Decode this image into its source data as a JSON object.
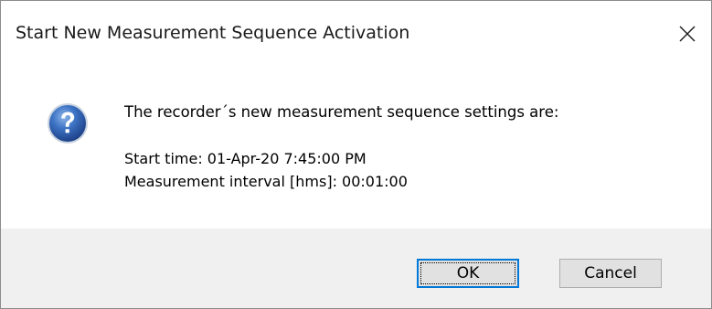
{
  "dialog": {
    "title": "Start New Measurement Sequence Activation",
    "close_icon": "close-icon",
    "message_icon": "question-icon",
    "message": {
      "line1": "The recorder´s new measurement sequence settings are:",
      "line2": "Start time: 01-Apr-20 7:45:00 PM",
      "line3": "Measurement interval [hms]: 00:01:00"
    },
    "buttons": {
      "ok_label": "OK",
      "cancel_label": "Cancel"
    }
  },
  "colors": {
    "footer_bg": "#f0f0f0",
    "button_bg": "#e1e1e1",
    "focus_border": "#0078d7",
    "icon_blue": "#2a5fb0"
  }
}
